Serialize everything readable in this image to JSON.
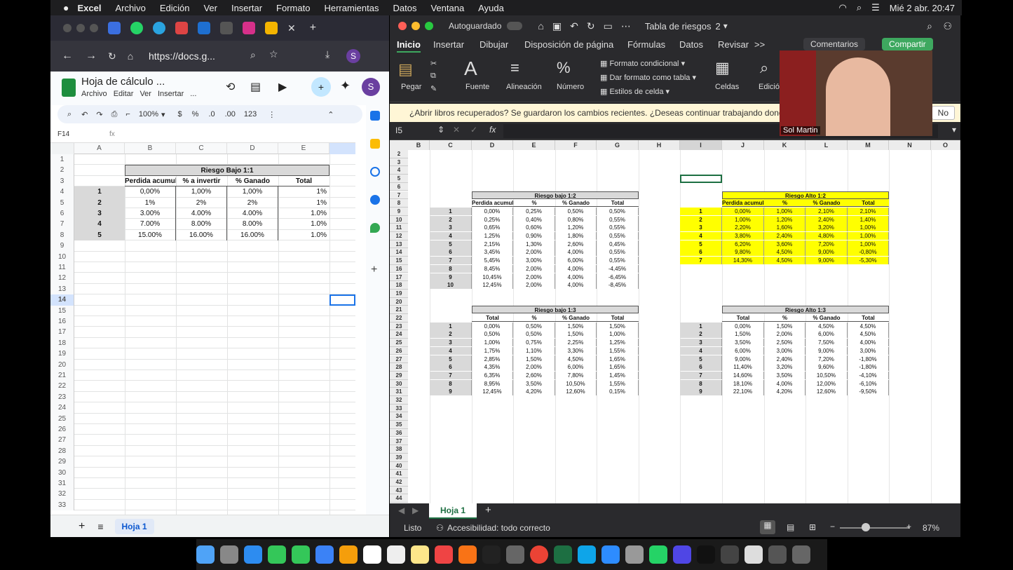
{
  "menubar": {
    "apple": "",
    "app": "Excel",
    "items": [
      "Archivo",
      "Edición",
      "Ver",
      "Insertar",
      "Formato",
      "Herramientas",
      "Datos",
      "Ventana",
      "Ayuda"
    ],
    "clock": "Mié 2 abr.  20:47"
  },
  "chrome": {
    "url": "https://docs.g...",
    "tab_add": "+"
  },
  "sheets": {
    "title": "Hoja de cálculo ...",
    "menu": [
      "Archivo",
      "Editar",
      "Ver",
      "Insertar",
      "..."
    ],
    "zoom": "100%",
    "toolbar_currency": "$",
    "toolbar_percent": "%",
    "toolbar_dec_down": ".0",
    "toolbar_dec_up": ".00",
    "toolbar_format": "123",
    "avatar": "S",
    "name_box": "F14",
    "fx": "fx",
    "columns": [
      "A",
      "B",
      "C",
      "D",
      "E"
    ],
    "rows": [
      "1",
      "2",
      "3",
      "4",
      "5",
      "6",
      "7",
      "8",
      "9",
      "10",
      "11",
      "12",
      "13",
      "14",
      "15",
      "16",
      "17",
      "18",
      "19",
      "20",
      "21",
      "22",
      "23",
      "24",
      "25",
      "26",
      "27",
      "28",
      "29",
      "30",
      "31",
      "32",
      "33"
    ],
    "table_title": "Riesgo Bajo 1:1",
    "headers": [
      "Perdida acumulad",
      "% a invertir",
      "% Ganado",
      "Total"
    ],
    "data": [
      [
        "1",
        "0,00%",
        "1,00%",
        "1,00%",
        "1%"
      ],
      [
        "2",
        "1%",
        "2%",
        "2%",
        "1%"
      ],
      [
        "3",
        "3.00%",
        "4.00%",
        "4.00%",
        "1.0%"
      ],
      [
        "4",
        "7.00%",
        "8.00%",
        "8.00%",
        "1.0%"
      ],
      [
        "5",
        "15.00%",
        "16.00%",
        "16.00%",
        "1.0%"
      ]
    ],
    "sheet_tab": "Hoja 1"
  },
  "excel": {
    "autosave": "Autoguardado",
    "doc_title": "Tabla de riesgos",
    "doc_suffix": "2",
    "tabs": [
      "Inicio",
      "Insertar",
      "Dibujar",
      "Disposición de página",
      "Fórmulas",
      "Datos",
      "Revisar"
    ],
    "more": ">>",
    "comments": "Comentarios",
    "share": "Compartir",
    "ribbon": {
      "paste": "Pegar",
      "font": "Fuente",
      "align": "Alineación",
      "number": "Número",
      "cond": "Formato condicional",
      "table": "Dar formato como tabla",
      "styles": "Estilos de celda",
      "cells": "Celdas",
      "edit": "Edición"
    },
    "message": "¿Abrir libros recuperados?  Se guardaron los cambios recientes. ¿Deseas continuar trabajando donde l",
    "msg_no": "No",
    "name_box": "I5",
    "fx": "fx",
    "columns": [
      "B",
      "C",
      "D",
      "E",
      "F",
      "G",
      "H",
      "I",
      "J",
      "K",
      "L",
      "M",
      "N",
      "O"
    ],
    "rows": [
      "2",
      "3",
      "4",
      "5",
      "6",
      "7",
      "8",
      "9",
      "10",
      "11",
      "12",
      "13",
      "14",
      "15",
      "16",
      "17",
      "18",
      "19",
      "20",
      "21",
      "22",
      "23",
      "24",
      "25",
      "26",
      "27",
      "28",
      "29",
      "30",
      "31",
      "32",
      "33",
      "34",
      "35",
      "36",
      "37",
      "38",
      "39",
      "40",
      "41",
      "42",
      "43",
      "44"
    ],
    "t1": {
      "title": "Riesgo bajo 1:2",
      "headers": [
        "Perdida acumulad",
        "%",
        "% Ganado",
        "Total"
      ],
      "rows": [
        [
          "1",
          "0,00%",
          "0,25%",
          "0,50%",
          "0,50%"
        ],
        [
          "2",
          "0,25%",
          "0,40%",
          "0,80%",
          "0,55%"
        ],
        [
          "3",
          "0,65%",
          "0,60%",
          "1,20%",
          "0,55%"
        ],
        [
          "4",
          "1,25%",
          "0,90%",
          "1,80%",
          "0,55%"
        ],
        [
          "5",
          "2,15%",
          "1,30%",
          "2,60%",
          "0,45%"
        ],
        [
          "6",
          "3,45%",
          "2,00%",
          "4,00%",
          "0,55%"
        ],
        [
          "7",
          "5,45%",
          "3,00%",
          "6,00%",
          "0,55%"
        ],
        [
          "8",
          "8,45%",
          "2,00%",
          "4,00%",
          "-4,45%"
        ],
        [
          "9",
          "10,45%",
          "2,00%",
          "4,00%",
          "-6,45%"
        ],
        [
          "10",
          "12,45%",
          "2,00%",
          "4,00%",
          "-8,45%"
        ]
      ]
    },
    "t2": {
      "title": "Riesgo Alto 1:2",
      "headers": [
        "Perdida acumulad",
        "%",
        "% Ganado",
        "Total"
      ],
      "rows": [
        [
          "1",
          "0,00%",
          "1,00%",
          "2,10%",
          "2,10%"
        ],
        [
          "2",
          "1,00%",
          "1,20%",
          "2,40%",
          "1,40%"
        ],
        [
          "3",
          "2,20%",
          "1,60%",
          "3,20%",
          "1,00%"
        ],
        [
          "4",
          "3,80%",
          "2,40%",
          "4,80%",
          "1,00%"
        ],
        [
          "5",
          "6,20%",
          "3,60%",
          "7,20%",
          "1,00%"
        ],
        [
          "6",
          "9,80%",
          "4,50%",
          "9,00%",
          "-0,80%"
        ],
        [
          "7",
          "14,30%",
          "4,50%",
          "9,00%",
          "-5,30%"
        ]
      ]
    },
    "t3": {
      "title": "Riesgo bajo 1:3",
      "headers": [
        "Total",
        "%",
        "% Ganado",
        "Total"
      ],
      "rows": [
        [
          "1",
          "0,00%",
          "0,50%",
          "1,50%",
          "1,50%"
        ],
        [
          "2",
          "0,50%",
          "0,50%",
          "1,50%",
          "1,00%"
        ],
        [
          "3",
          "1,00%",
          "0,75%",
          "2,25%",
          "1,25%"
        ],
        [
          "4",
          "1,75%",
          "1,10%",
          "3,30%",
          "1,55%"
        ],
        [
          "5",
          "2,85%",
          "1,50%",
          "4,50%",
          "1,65%"
        ],
        [
          "6",
          "4,35%",
          "2,00%",
          "6,00%",
          "1,65%"
        ],
        [
          "7",
          "6,35%",
          "2,60%",
          "7,80%",
          "1,45%"
        ],
        [
          "8",
          "8,95%",
          "3,50%",
          "10,50%",
          "1,55%"
        ],
        [
          "9",
          "12,45%",
          "4,20%",
          "12,60%",
          "0,15%"
        ]
      ]
    },
    "t4": {
      "title": "Riesgo Alto 1:3",
      "headers": [
        "Total",
        "%",
        "% Ganado",
        "Total"
      ],
      "rows": [
        [
          "1",
          "0,00%",
          "1,50%",
          "4,50%",
          "4,50%"
        ],
        [
          "2",
          "1,50%",
          "2,00%",
          "6,00%",
          "4,50%"
        ],
        [
          "3",
          "3,50%",
          "2,50%",
          "7,50%",
          "4,00%"
        ],
        [
          "4",
          "6,00%",
          "3,00%",
          "9,00%",
          "3,00%"
        ],
        [
          "5",
          "9,00%",
          "2,40%",
          "7,20%",
          "-1,80%"
        ],
        [
          "6",
          "11,40%",
          "3,20%",
          "9,60%",
          "-1,80%"
        ],
        [
          "7",
          "14,60%",
          "3,50%",
          "10,50%",
          "-4,10%"
        ],
        [
          "8",
          "18,10%",
          "4,00%",
          "12,00%",
          "-6,10%"
        ],
        [
          "9",
          "22,10%",
          "4,20%",
          "12,60%",
          "-9,50%"
        ]
      ]
    },
    "sheet_tab": "Hoja 1",
    "status": "Listo",
    "accessibility": "Accesibilidad: todo correcto",
    "zoom": "87%"
  },
  "video": {
    "name": "Sol Martin"
  }
}
